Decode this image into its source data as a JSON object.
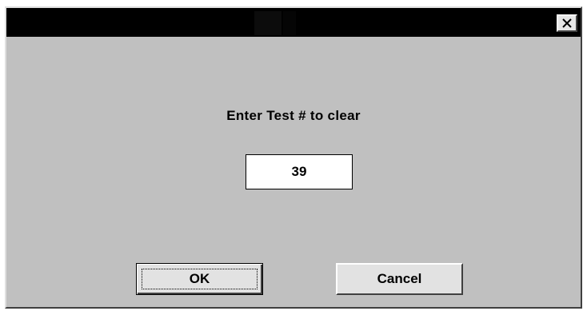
{
  "window": {
    "title": "",
    "close_icon": "close-x-icon"
  },
  "dialog": {
    "prompt": "Enter Test # to clear",
    "input_value": "39",
    "ok_label": "OK",
    "cancel_label": "Cancel"
  },
  "colors": {
    "title_bar": "#000000",
    "face": "#c0c0c0",
    "button_face": "#e2e2e2"
  }
}
